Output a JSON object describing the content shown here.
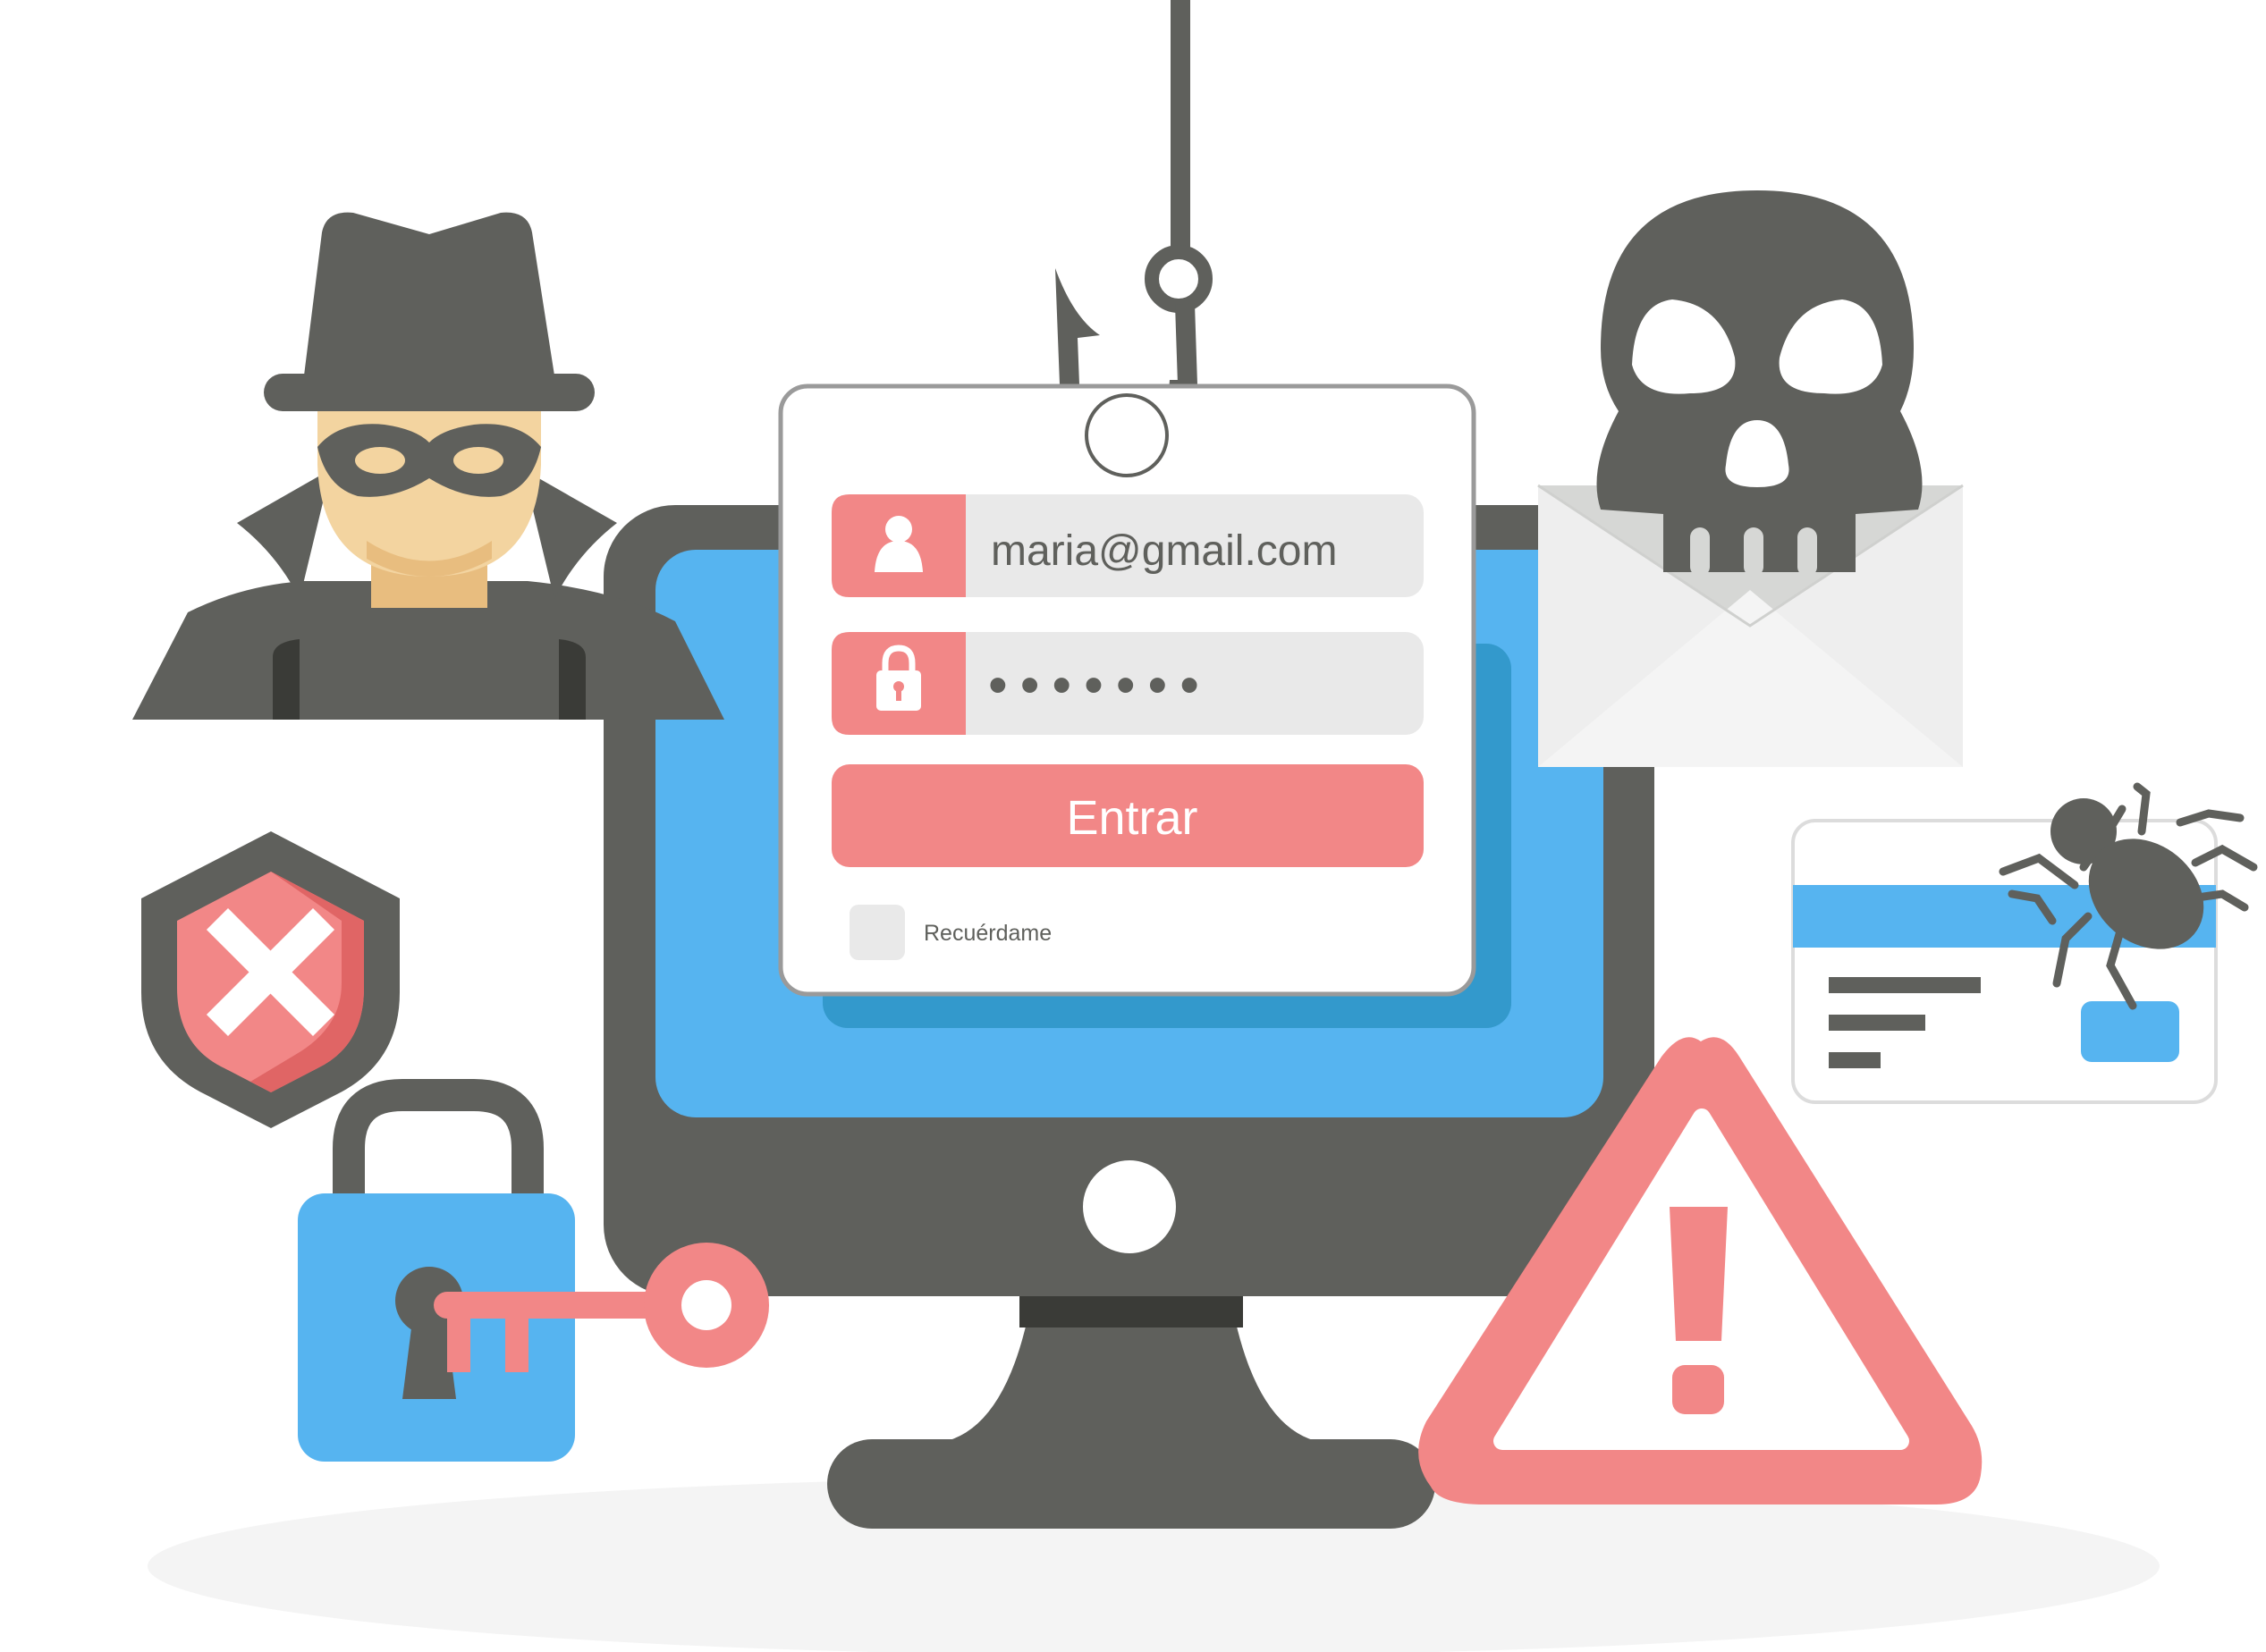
{
  "login_form": {
    "email_value": "maria@gmail.com",
    "password_masked": "•••••••",
    "submit_label": "Entrar",
    "remember_label": "Recuérdame"
  },
  "icons": [
    "hacker-icon",
    "fishing-hook-icon",
    "skull-icon",
    "envelope-icon",
    "bug-icon",
    "credit-card-icon",
    "shield-x-icon",
    "padlock-icon",
    "key-icon",
    "warning-triangle-icon",
    "user-icon",
    "lock-icon",
    "monitor-icon"
  ],
  "colors": {
    "dark": "#5f605c",
    "darker": "#3a3b37",
    "blue": "#56b4f0",
    "blue_dark": "#3399cc",
    "pink": "#f28787",
    "pink_dark": "#de6262",
    "skin": "#f3d4a0",
    "light_gray": "#e9e9e9",
    "envelope": "#eeeeee"
  }
}
